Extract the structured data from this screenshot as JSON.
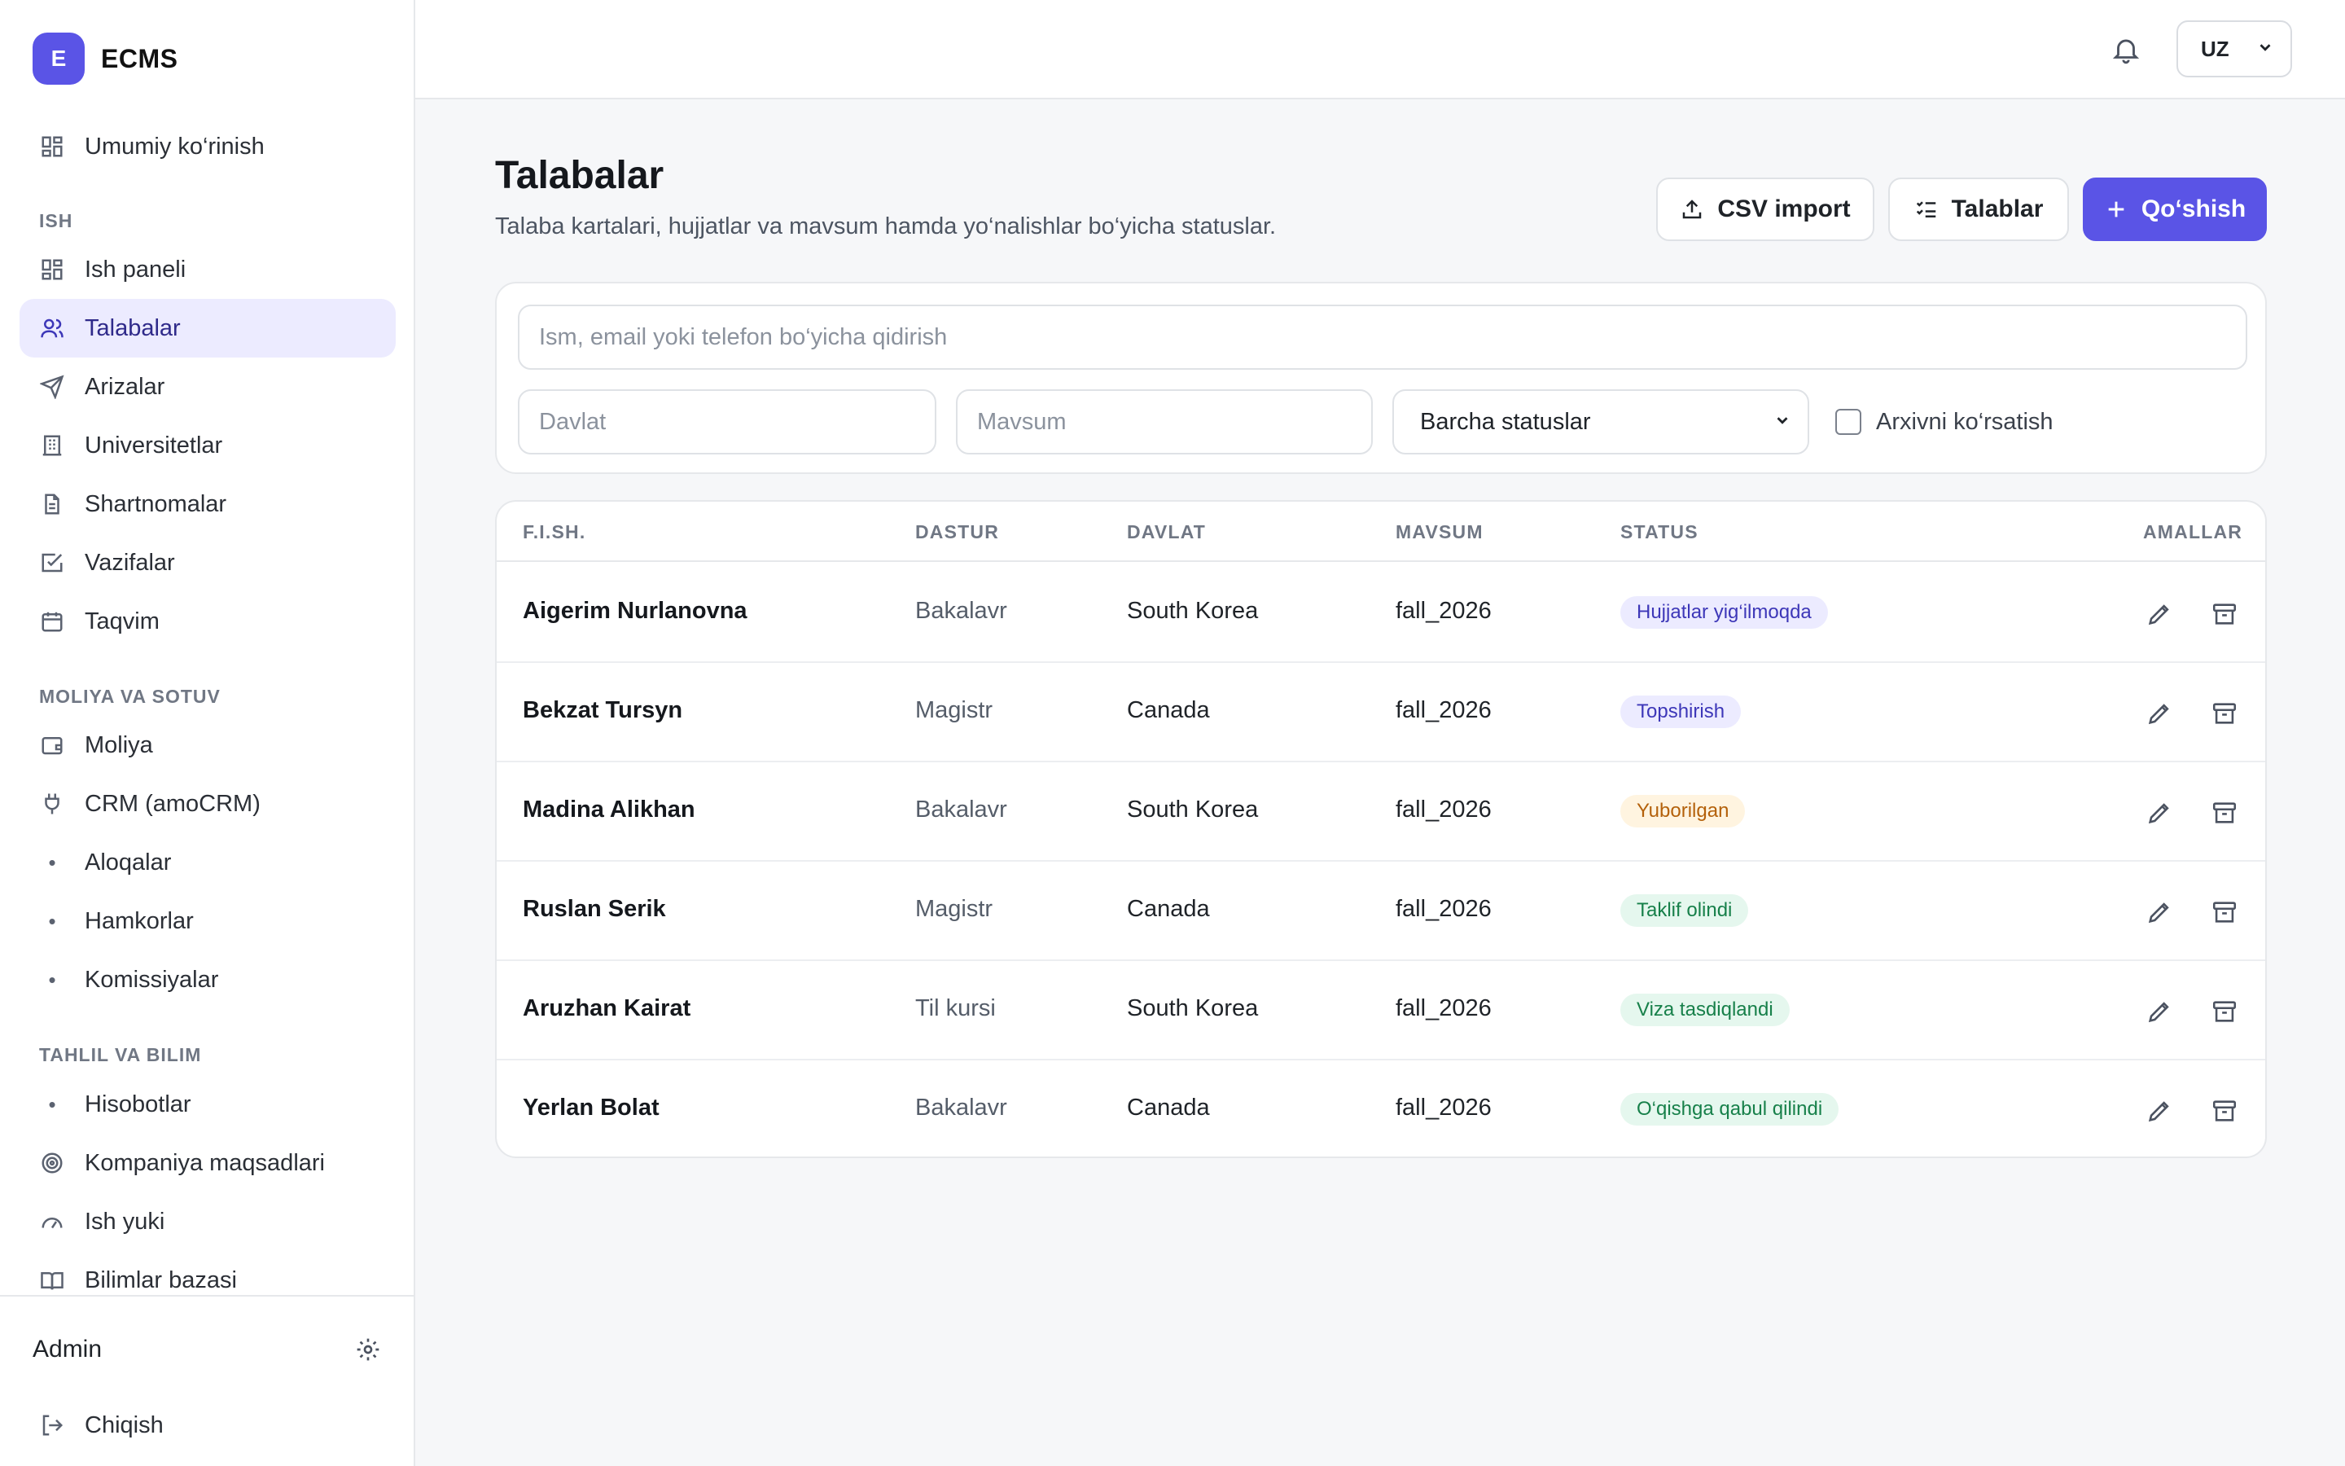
{
  "brand": {
    "logo_letter": "E",
    "name": "ECMS"
  },
  "sidebar": {
    "overview": {
      "label": "Umumiy ko‘rinish",
      "icon": "grid-icon"
    },
    "sections": [
      {
        "title": "ISH",
        "items": [
          {
            "label": "Ish paneli",
            "icon": "dashboard-icon"
          },
          {
            "label": "Talabalar",
            "icon": "users-icon",
            "active": true
          },
          {
            "label": "Arizalar",
            "icon": "send-icon"
          },
          {
            "label": "Universitetlar",
            "icon": "building-icon"
          },
          {
            "label": "Shartnomalar",
            "icon": "document-icon"
          },
          {
            "label": "Vazifalar",
            "icon": "checkbox-icon"
          },
          {
            "label": "Taqvim",
            "icon": "calendar-icon"
          }
        ]
      },
      {
        "title": "MOLIYA VA SOTUV",
        "items": [
          {
            "label": "Moliya",
            "icon": "wallet-icon"
          },
          {
            "label": "CRM (amoCRM)",
            "icon": "plug-icon"
          },
          {
            "label": "Aloqalar",
            "icon": "dot"
          },
          {
            "label": "Hamkorlar",
            "icon": "dot"
          },
          {
            "label": "Komissiyalar",
            "icon": "dot"
          }
        ]
      },
      {
        "title": "TAHLIL VA BILIM",
        "items": [
          {
            "label": "Hisobotlar",
            "icon": "dot"
          },
          {
            "label": "Kompaniya maqsadlari",
            "icon": "target-icon"
          },
          {
            "label": "Ish yuki",
            "icon": "gauge-icon"
          },
          {
            "label": "Bilimlar bazasi",
            "icon": "book-icon"
          }
        ]
      }
    ],
    "footer": {
      "user": "Admin",
      "logout": "Chiqish"
    }
  },
  "topbar": {
    "language": "UZ"
  },
  "page": {
    "title": "Talabalar",
    "subtitle": "Talaba kartalari, hujjatlar va mavsum hamda yo‘nalishlar bo‘yicha statuslar.",
    "buttons": {
      "csv": "CSV import",
      "requirements": "Talablar",
      "add": "Qo‘shish"
    }
  },
  "filters": {
    "search_placeholder": "Ism, email yoki telefon bo‘yicha qidirish",
    "country_placeholder": "Davlat",
    "season_placeholder": "Mavsum",
    "status_selected": "Barcha statuslar",
    "archive_label": "Arxivni ko‘rsatish"
  },
  "table": {
    "headers": {
      "name": "F.I.SH.",
      "program": "DASTUR",
      "country": "DAVLAT",
      "season": "MAVSUM",
      "status": "STATUS",
      "actions": "AMALLAR"
    },
    "rows": [
      {
        "name": "Aigerim Nurlanovna",
        "program": "Bakalavr",
        "country": "South Korea",
        "season": "fall_2026",
        "status": "Hujjatlar yig‘ilmoqda",
        "status_bg": "#ecebff",
        "status_fg": "#3d37b8"
      },
      {
        "name": "Bekzat Tursyn",
        "program": "Magistr",
        "country": "Canada",
        "season": "fall_2026",
        "status": "Topshirish",
        "status_bg": "#ecebff",
        "status_fg": "#3d37b8"
      },
      {
        "name": "Madina Alikhan",
        "program": "Bakalavr",
        "country": "South Korea",
        "season": "fall_2026",
        "status": "Yuborilgan",
        "status_bg": "#fff4e0",
        "status_fg": "#b4610b"
      },
      {
        "name": "Ruslan Serik",
        "program": "Magistr",
        "country": "Canada",
        "season": "fall_2026",
        "status": "Taklif olindi",
        "status_bg": "#e5f7ee",
        "status_fg": "#17804a"
      },
      {
        "name": "Aruzhan Kairat",
        "program": "Til kursi",
        "country": "South Korea",
        "season": "fall_2026",
        "status": "Viza tasdiqlandi",
        "status_bg": "#e5f7ee",
        "status_fg": "#17804a"
      },
      {
        "name": "Yerlan Bolat",
        "program": "Bakalavr",
        "country": "Canada",
        "season": "fall_2026",
        "status": "O‘qishga qabul qilindi",
        "status_bg": "#e5f7ee",
        "status_fg": "#17804a"
      }
    ]
  },
  "colors": {
    "accent": "#5a54e6",
    "active_bg": "#ecebff"
  }
}
